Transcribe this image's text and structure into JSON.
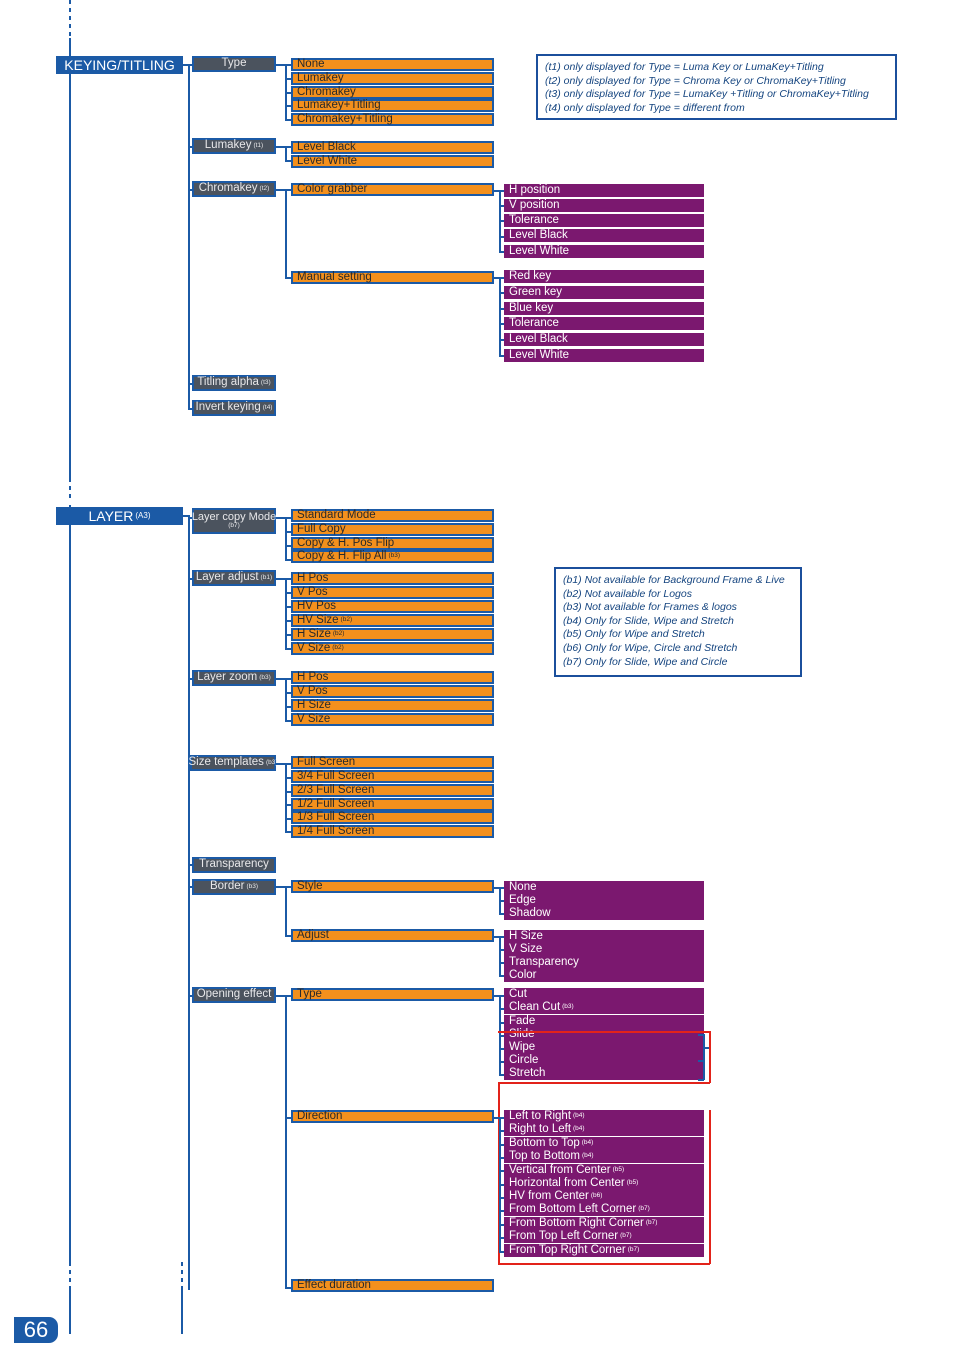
{
  "page": {
    "number": "66"
  },
  "sections": [
    {
      "id": "keying-titling",
      "root": {
        "label": "KEYING/TITLING",
        "note": ""
      },
      "groups": [
        {
          "label": "Type",
          "note": "",
          "items": [
            {
              "label": "None",
              "note": ""
            },
            {
              "label": "Lumakey",
              "note": ""
            },
            {
              "label": "Chromakey",
              "note": ""
            },
            {
              "label": "Lumakey+Titling",
              "note": ""
            },
            {
              "label": "Chromakey+Titling",
              "note": ""
            }
          ]
        },
        {
          "label": "Lumakey",
          "note": "(t1)",
          "items": [
            {
              "label": "Level Black",
              "note": ""
            },
            {
              "label": "Level White",
              "note": ""
            }
          ]
        },
        {
          "label": "Chromakey",
          "note": "(t2)",
          "items": [
            {
              "label": "Color grabber",
              "note": "",
              "sub": [
                {
                  "label": "H position",
                  "note": ""
                },
                {
                  "label": "V position",
                  "note": ""
                },
                {
                  "label": "Tolerance",
                  "note": ""
                },
                {
                  "label": "Level Black",
                  "note": ""
                },
                {
                  "label": "Level White",
                  "note": ""
                }
              ]
            },
            {
              "label": "Manual setting",
              "note": "",
              "sub": [
                {
                  "label": "Red key",
                  "note": ""
                },
                {
                  "label": "Green key",
                  "note": ""
                },
                {
                  "label": "Blue key",
                  "note": ""
                },
                {
                  "label": "Tolerance",
                  "note": ""
                },
                {
                  "label": "Level Black",
                  "note": ""
                },
                {
                  "label": "Level White",
                  "note": ""
                }
              ]
            }
          ]
        },
        {
          "label": "Titling alpha",
          "note": "(t3)",
          "items": []
        },
        {
          "label": "Invert keying",
          "note": "(t4)",
          "items": []
        }
      ],
      "notes": [
        "(t1) only displayed for Type = Luma Key or LumaKey+Titling",
        "(t2) only displayed for Type = Chroma Key or ChromaKey+Titling",
        "(t3) only displayed for Type = LumaKey +Titling or ChromaKey+Titling",
        "(t4) only displayed for Type = different from"
      ]
    },
    {
      "id": "layer",
      "root": {
        "label": "LAYER",
        "note": "(A3)"
      },
      "groups": [
        {
          "label": "Layer copy Mode",
          "note": "(b7)",
          "items": [
            {
              "label": "Standard Mode",
              "note": ""
            },
            {
              "label": "Full Copy",
              "note": ""
            },
            {
              "label": "Copy & H. Pos Flip",
              "note": ""
            },
            {
              "label": "Copy & H. Flip All",
              "note": "(b3)"
            }
          ]
        },
        {
          "label": "Layer adjust",
          "note": "(b1)",
          "items": [
            {
              "label": "H Pos",
              "note": ""
            },
            {
              "label": "V Pos",
              "note": ""
            },
            {
              "label": "HV Pos",
              "note": ""
            },
            {
              "label": "HV Size",
              "note": "(b2)"
            },
            {
              "label": "H Size",
              "note": "(b2)"
            },
            {
              "label": "V Size",
              "note": "(b2)"
            }
          ]
        },
        {
          "label": "Layer zoom",
          "note": "(b3)",
          "items": [
            {
              "label": "H Pos",
              "note": ""
            },
            {
              "label": "V Pos",
              "note": ""
            },
            {
              "label": "H Size",
              "note": ""
            },
            {
              "label": "V Size",
              "note": ""
            }
          ]
        },
        {
          "label": "Size templates",
          "note": "(b3)",
          "items": [
            {
              "label": "Full Screen",
              "note": ""
            },
            {
              "label": "3/4 Full Screen",
              "note": ""
            },
            {
              "label": "2/3 Full Screen",
              "note": ""
            },
            {
              "label": "1/2 Full Screen",
              "note": ""
            },
            {
              "label": "1/3 Full Screen",
              "note": ""
            },
            {
              "label": "1/4 Full Screen",
              "note": ""
            }
          ]
        },
        {
          "label": "Transparency",
          "note": "",
          "items": []
        },
        {
          "label": "Border",
          "note": "(b3)",
          "items": [
            {
              "label": "Style",
              "note": "",
              "sub": [
                {
                  "label": "None",
                  "note": ""
                },
                {
                  "label": "Edge",
                  "note": ""
                },
                {
                  "label": "Shadow",
                  "note": ""
                }
              ]
            },
            {
              "label": "Adjust",
              "note": "",
              "sub": [
                {
                  "label": "H Size",
                  "note": ""
                },
                {
                  "label": "V Size",
                  "note": ""
                },
                {
                  "label": "Transparency",
                  "note": ""
                },
                {
                  "label": "Color",
                  "note": ""
                }
              ]
            }
          ]
        },
        {
          "label": "Opening effect",
          "note": "",
          "items": [
            {
              "label": "Type",
              "note": "",
              "sub": [
                {
                  "label": "Cut",
                  "note": ""
                },
                {
                  "label": "Clean Cut",
                  "note": "(b3)"
                },
                {
                  "label": "Fade",
                  "note": ""
                },
                {
                  "label": "Slide",
                  "note": ""
                },
                {
                  "label": "Wipe",
                  "note": ""
                },
                {
                  "label": "Circle",
                  "note": ""
                },
                {
                  "label": "Stretch",
                  "note": ""
                }
              ]
            },
            {
              "label": "Direction",
              "note": "",
              "sub": [
                {
                  "label": "Left to Right",
                  "note": "(b4)"
                },
                {
                  "label": "Right to Left",
                  "note": "(b4)"
                },
                {
                  "label": "Bottom to Top",
                  "note": "(b4)"
                },
                {
                  "label": "Top to Bottom",
                  "note": "(b4)"
                },
                {
                  "label": "Vertical from Center",
                  "note": "(b5)"
                },
                {
                  "label": "Horizontal from Center",
                  "note": "(b5)"
                },
                {
                  "label": "HV from Center",
                  "note": "(b6)"
                },
                {
                  "label": "From Bottom Left Corner",
                  "note": "(b7)"
                },
                {
                  "label": "From Bottom Right Corner",
                  "note": "(b7)"
                },
                {
                  "label": "From Top Left Corner",
                  "note": "(b7)"
                },
                {
                  "label": "From Top Right Corner",
                  "note": "(b7)"
                }
              ]
            },
            {
              "label": "Effect duration",
              "note": ""
            }
          ]
        }
      ],
      "notes": [
        "(b1) Not available for Background Frame & Live",
        "(b2) Not available for Logos",
        "(b3) Not available for Frames & logos",
        "(b4) Only for Slide, Wipe and Stretch",
        "(b5) Only for Wipe and Stretch",
        "(b6) Only for Wipe, Circle and Stretch",
        "(b7) Only for Slide, Wipe and Circle"
      ]
    }
  ],
  "colors": {
    "root": "#1b5aa6",
    "level1": "#4b535e",
    "level2": "#f3901d",
    "level3": "#7b186f",
    "connector": "#1b5aa6",
    "highlight": "#e2231a"
  }
}
